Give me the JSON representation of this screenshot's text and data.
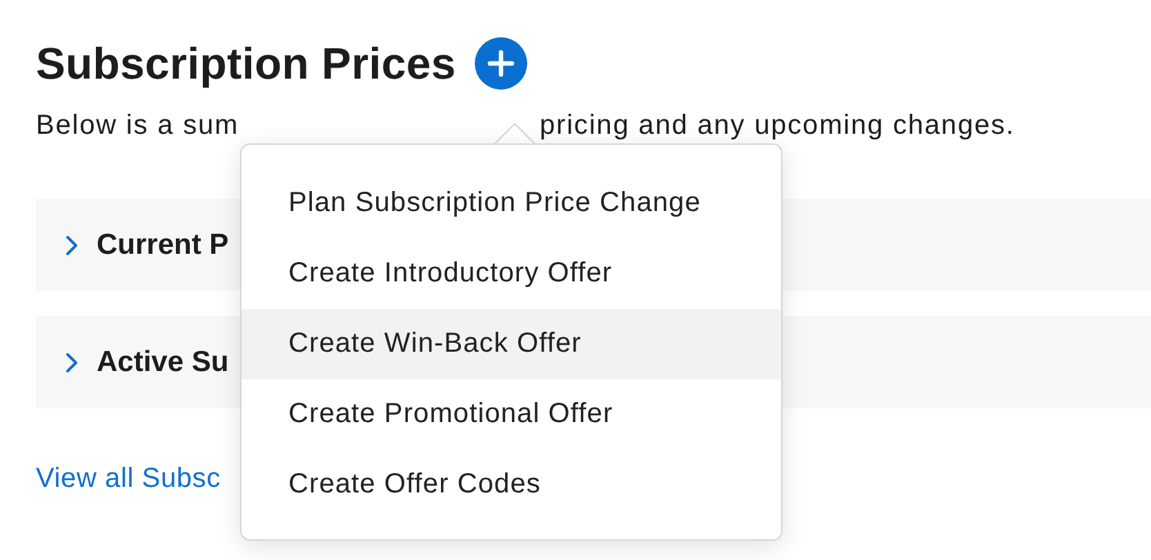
{
  "header": {
    "title": "Subscription Prices"
  },
  "description": [
    "Below is a sum",
    "pricing and any upcoming changes."
  ],
  "sections": [
    {
      "title": "Current P",
      "expanded": false
    },
    {
      "title": "Active Su",
      "expanded": false
    }
  ],
  "link": "View all Subsc",
  "menu": {
    "items": [
      {
        "label": "Plan Subscription Price Change",
        "selected": false
      },
      {
        "label": "Create Introductory Offer",
        "selected": false
      },
      {
        "label": "Create Win-Back Offer",
        "selected": true
      },
      {
        "label": "Create Promotional Offer",
        "selected": false
      },
      {
        "label": "Create Offer Codes",
        "selected": false
      }
    ]
  }
}
